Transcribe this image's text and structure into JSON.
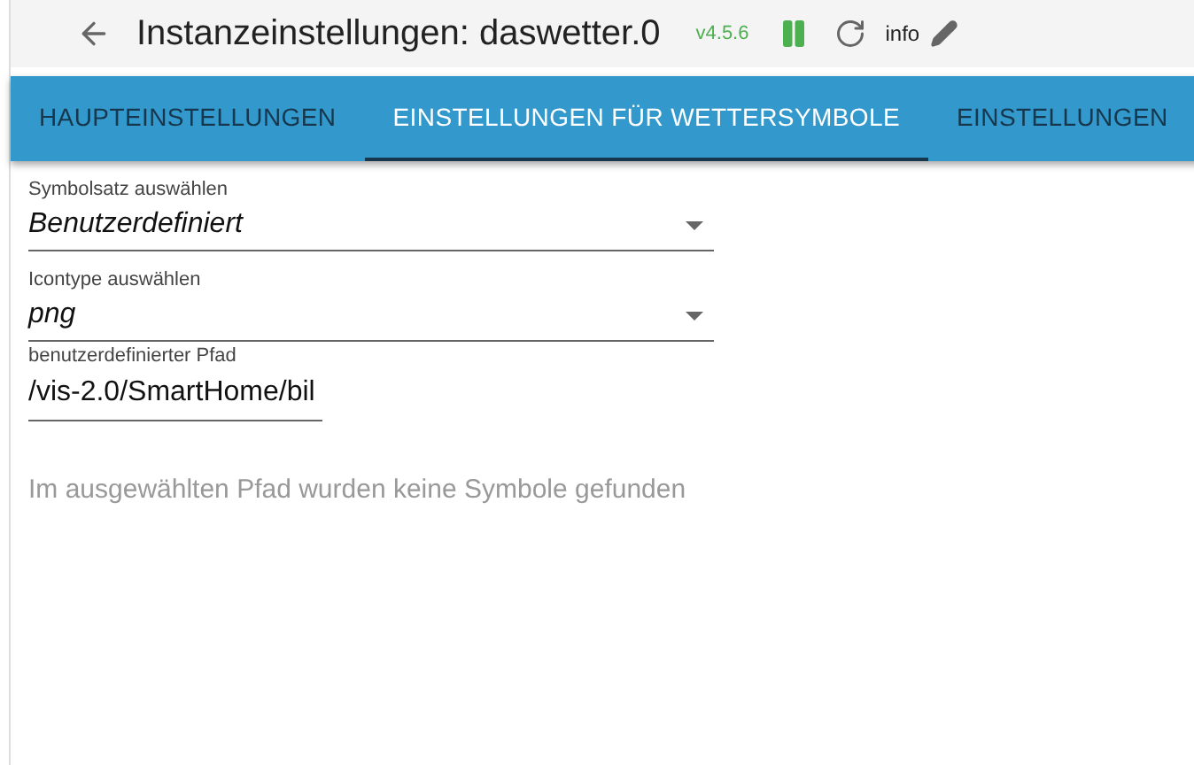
{
  "header": {
    "title": "Instanzeinstellungen: daswetter.0",
    "version": "v4.5.6",
    "info": "info"
  },
  "tabs": [
    {
      "label": "HAUPTEINSTELLUNGEN",
      "selected": false
    },
    {
      "label": "EINSTELLUNGEN FÜR WETTERSYMBOLE",
      "selected": true
    },
    {
      "label": "EINSTELLUNGEN",
      "selected": false
    }
  ],
  "fields": [
    {
      "kind": "select",
      "label": "Symbolsatz auswählen",
      "value": "Benutzerdefiniert"
    },
    {
      "kind": "select",
      "label": "Icontype auswählen",
      "value": "png"
    },
    {
      "kind": "text",
      "label": "benutzerdefinierter Pfad",
      "value": "/vis-2.0/SmartHome/bil"
    }
  ],
  "message": "Im ausgewählten Pfad wurden keine Symbole gefunden"
}
